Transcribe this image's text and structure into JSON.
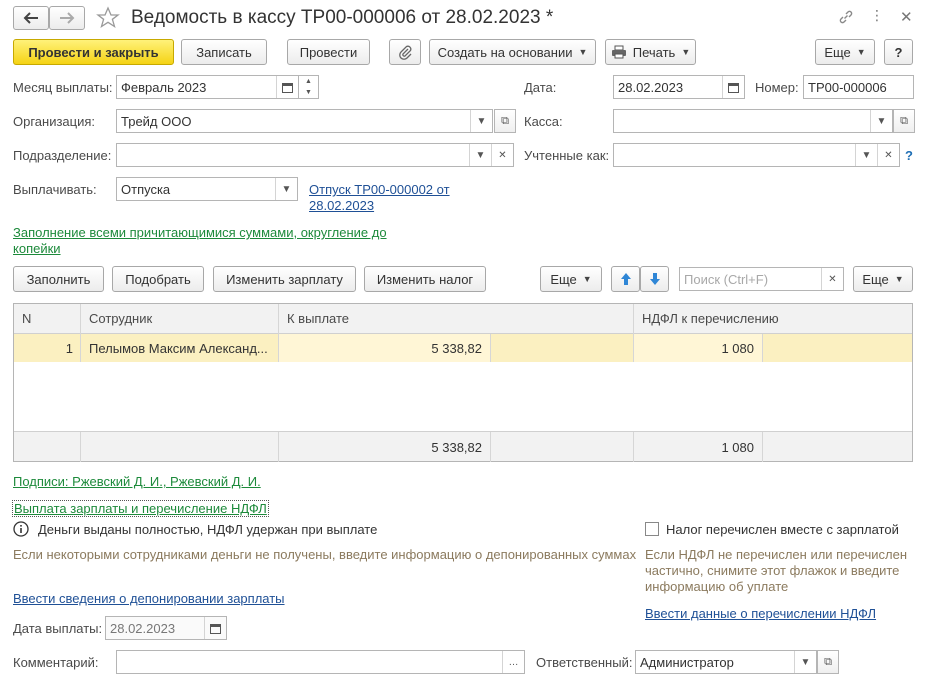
{
  "window": {
    "title": "Ведомость в кассу ТР00-000006 от 28.02.2023 *",
    "icons": [
      "back-arrow-icon",
      "forward-arrow-icon",
      "star-icon",
      "link-icon",
      "more-vertical-icon",
      "close-icon"
    ]
  },
  "toolbar": {
    "post_close": "Провести и закрыть",
    "save": "Записать",
    "post": "Провести",
    "create_based": "Создать на основании",
    "print": "Печать",
    "more": "Еще",
    "help": "?"
  },
  "form": {
    "month_label": "Месяц выплаты:",
    "month_value": "Февраль 2023",
    "date_label": "Дата:",
    "date_value": "28.02.2023",
    "number_label": "Номер:",
    "number_value": "ТР00-000006",
    "org_label": "Организация:",
    "org_value": "Трейд ООО",
    "cash_label": "Касса:",
    "cash_value": "",
    "dept_label": "Подразделение:",
    "dept_value": "",
    "accounted_label": "Учтенные как:",
    "accounted_value": "",
    "accounted_help": "?",
    "pay_label": "Выплачивать:",
    "pay_value": "Отпуска",
    "pay_link": "Отпуск ТР00-000002 от 28.02.2023",
    "fill_note": "Заполнение всеми причитающимися суммами, округление до копейки"
  },
  "table_toolbar": {
    "fill": "Заполнить",
    "pick": "Подобрать",
    "change_salary": "Изменить зарплату",
    "change_tax": "Изменить налог",
    "more": "Еще",
    "search_placeholder": "Поиск (Ctrl+F)",
    "more2": "Еще"
  },
  "table": {
    "headers": [
      "N",
      "Сотрудник",
      "К выплате",
      "НДФЛ к перечислению"
    ],
    "rows": [
      {
        "n": "1",
        "employee": "Пелымов Максим Александ...",
        "to_pay": "5 338,82",
        "ndfl": "1 080"
      }
    ],
    "footer": {
      "to_pay": "5 338,82",
      "ndfl": "1 080"
    }
  },
  "bottom": {
    "signatures": "Подписи: Ржевский Д. И., Ржевский Д. И.",
    "section_link": "Выплата зарплаты и перечисление НДФЛ",
    "info_text": "Деньги выданы полностью, НДФЛ удержан при выплате",
    "info_hint": "Если некоторыми сотрудниками деньги не получены, введите информацию о депонированных суммах",
    "tax_checkbox_label": "Налог перечислен вместе с зарплатой",
    "tax_checked": false,
    "tax_hint": "Если НДФЛ не перечислен или перечислен частично, снимите этот флажок и введите информацию об уплате",
    "deposit_link": "Ввести сведения о депонировании зарплаты",
    "ndfl_link": "Ввести данные о перечислении НДФЛ",
    "pay_date_label": "Дата выплаты:",
    "pay_date_value": "28.02.2023",
    "comment_label": "Комментарий:",
    "comment_value": "",
    "responsible_label": "Ответственный:",
    "responsible_value": "Администратор"
  },
  "colors": {
    "primary_button": "#f5d315",
    "selected_row": "#fbf0c1",
    "link_blue": "#1f5096",
    "link_green": "#1d8a3b",
    "hint": "#8b7a5e"
  }
}
